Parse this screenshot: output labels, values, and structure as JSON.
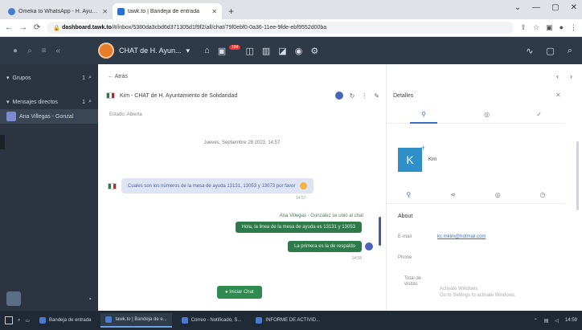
{
  "browser": {
    "tabs": [
      {
        "label": "Omeka to WhatsApp - H. Ayun...",
        "active": false
      },
      {
        "label": "tawk.to | Bandeja de entrada",
        "active": true
      }
    ],
    "url_domain": "dashboard.tawk.to",
    "url_rest": "/#/inbox/5380da3cbd6d371305d1f9f2/all/chat/79f0ebf0-0a36-11ee-9fde-ebf9552d00ba"
  },
  "app": {
    "brand": "CHAT de H. Ayun...",
    "badge": "184",
    "sidebar": {
      "groups_label": "Grupos",
      "groups_count": "1",
      "direct_label": "Mensajes directos",
      "direct_count": "1",
      "contact": "Ana Villegas - Gonzal"
    }
  },
  "chat": {
    "back": "Atrás",
    "title": "Kim - CHAT de H. Ayuntamiento de Solidaridad",
    "status": "Estado: Abierta",
    "date": "Jueves, Septiembre 28 2023, 14:57",
    "incoming": "Cuales son los números de la mesa de ayuda 13131, 13053 y 13073 por favor",
    "incoming_time": "14:57",
    "sender": "Ana Villegas - Gonzalez se unió al chat",
    "outgoing1": "Hola, la linea de la mesa de ayuda es 13131 y 13053",
    "outgoing2": "La primera es la de respaldo",
    "outgoing_time": "14:58",
    "button": "Iniciar Chat"
  },
  "details": {
    "title": "Detalles",
    "contact_initial": "K",
    "contact_name": "Kim",
    "about": "About",
    "email_label": "E-mail",
    "email_value": "kc.mkim@hotmail.com",
    "phone_label": "Phone",
    "visits_label1": "Total de",
    "visits_label2": "visitas",
    "activate1": "Activate Windows",
    "activate2": "Go to Settings to activate Windows."
  },
  "taskbar": {
    "items": [
      "Bandeja de entrada",
      "tawk.to | Bandeja de e...",
      "Correo - Notificado, S...",
      "INFORME DE ACTIVID..."
    ],
    "clock": "14:59"
  }
}
